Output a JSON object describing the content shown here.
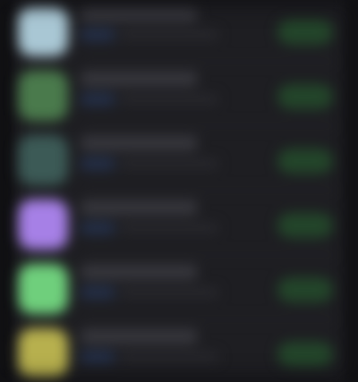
{
  "list": {
    "rows": [
      {
        "name": "",
        "subtitle": "",
        "detail": "",
        "button_label": "",
        "icon": "app-icon",
        "icon_color": "#a9c7d4"
      },
      {
        "name": "",
        "subtitle": "",
        "detail": "",
        "button_label": "",
        "icon": "app-icon",
        "icon_color": "#4a7a4c"
      },
      {
        "name": "",
        "subtitle": "",
        "detail": "",
        "button_label": "",
        "icon": "app-icon",
        "icon_color": "#3c5a56"
      },
      {
        "name": "",
        "subtitle": "",
        "detail": "",
        "button_label": "",
        "icon": "app-icon",
        "icon_color": "#a680e6"
      },
      {
        "name": "",
        "subtitle": "",
        "detail": "",
        "button_label": "",
        "icon": "app-icon",
        "icon_color": "#6fcf7c"
      },
      {
        "name": "",
        "subtitle": "",
        "detail": "",
        "button_label": "",
        "icon": "app-icon",
        "icon_color": "#b7b04e"
      }
    ]
  },
  "colors": {
    "background": "#1c1c1f",
    "button_green": "#23452a",
    "subtitle_blue": "#24304a"
  }
}
